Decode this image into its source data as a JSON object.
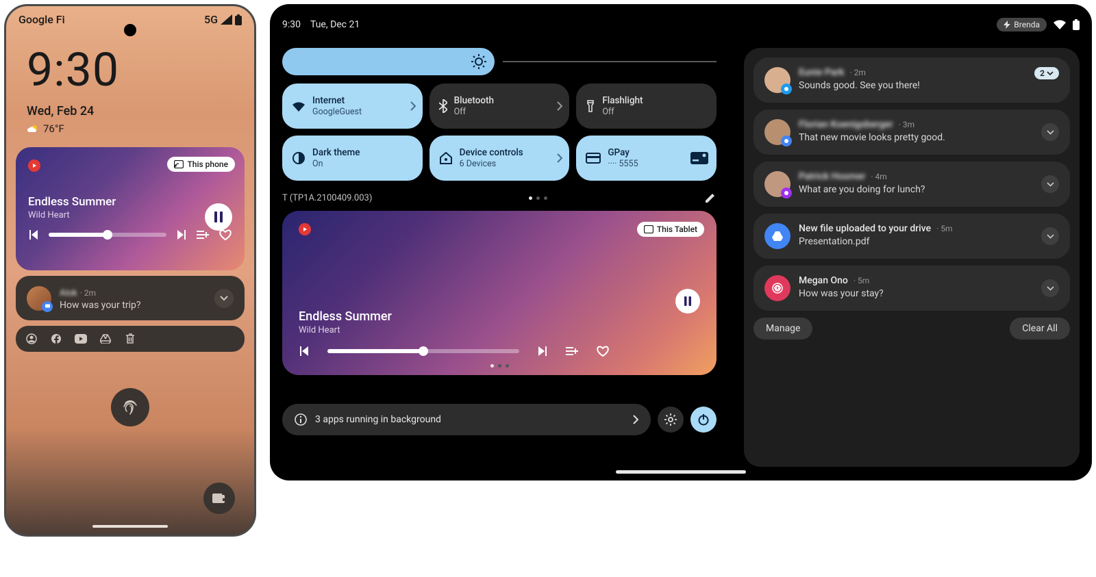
{
  "phone": {
    "carrier": "Google Fi",
    "network": "5G",
    "time": "9:30",
    "date": "Wed, Feb 24",
    "temp": "76°F",
    "media": {
      "cast_label": "This phone",
      "title": "Endless Summer",
      "artist": "Wild Heart"
    },
    "notif": {
      "name": "Alok",
      "time": "2m",
      "msg": "How was your trip?"
    }
  },
  "tablet": {
    "time": "9:30",
    "date": "Tue, Dec 21",
    "dnd_label": "Brenda",
    "qs": [
      {
        "title": "Internet",
        "sub": "GoogleGuest",
        "on": true,
        "chev": true
      },
      {
        "title": "Bluetooth",
        "sub": "Off",
        "on": false,
        "chev": true
      },
      {
        "title": "Flashlight",
        "sub": "Off",
        "on": false
      },
      {
        "title": "Dark theme",
        "sub": "On",
        "on": true
      },
      {
        "title": "Device controls",
        "sub": "6 Devices",
        "on": true,
        "chev": true
      },
      {
        "title": "GPay",
        "sub": "···· 5555",
        "on": true,
        "card": true
      }
    ],
    "build": "T (TP1A.2100409.003)",
    "media": {
      "cast_label": "This Tablet",
      "title": "Endless Summer",
      "artist": "Wild Heart"
    },
    "bg_apps": "3 apps running in background",
    "notifs": [
      {
        "name": "Eunie Park",
        "time": "2m",
        "msg": "Sounds good. See you there!",
        "badge": "2",
        "app": "twitter",
        "blur": true
      },
      {
        "name": "Florian Koenigsberger",
        "time": "3m",
        "msg": "That new movie looks pretty good.",
        "app": "messages",
        "blur": true
      },
      {
        "name": "Patrick Hosmer",
        "time": "4m",
        "msg": "What are you doing for lunch?",
        "app": "messenger",
        "blur": true
      },
      {
        "name": "New file uploaded to your drive",
        "time": "5m",
        "msg": "Presentation.pdf",
        "system": true,
        "icon": "drive"
      },
      {
        "name": "Megan Ono",
        "time": "5m",
        "msg": "How was your stay?",
        "system": true,
        "icon": "airbnb"
      }
    ],
    "manage": "Manage",
    "clear": "Clear All"
  }
}
